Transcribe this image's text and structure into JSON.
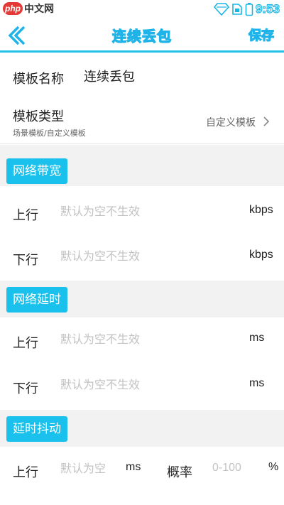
{
  "watermark": {
    "logo": "php",
    "text": "中文网"
  },
  "status_bar": {
    "time": "9:53"
  },
  "header": {
    "title": "连续丢包",
    "save_label": "保存"
  },
  "template_name": {
    "label": "模板名称",
    "value": "连续丢包"
  },
  "template_type": {
    "label": "模板类型",
    "sub_label": "场景模板/自定义模板",
    "value": "自定义模板"
  },
  "bandwidth": {
    "section_label": "网络带宽",
    "uplink": {
      "label": "上行",
      "placeholder": "默认为空不生效",
      "unit": "kbps"
    },
    "downlink": {
      "label": "下行",
      "placeholder": "默认为空不生效",
      "unit": "kbps"
    }
  },
  "latency": {
    "section_label": "网络延时",
    "uplink": {
      "label": "上行",
      "placeholder": "默认为空不生效",
      "unit": "ms"
    },
    "downlink": {
      "label": "下行",
      "placeholder": "默认为空不生效",
      "unit": "ms"
    }
  },
  "jitter": {
    "section_label": "延时抖动",
    "uplink": {
      "label": "上行",
      "placeholder": "默认为空",
      "unit": "ms",
      "probability_label": "概率",
      "probability_placeholder": "0-100",
      "probability_unit": "%"
    }
  },
  "colors": {
    "accent": "#19c1ec",
    "section_bg": "#f2f2f2",
    "placeholder": "#c2c2c2"
  },
  "icons": [
    "wifi-icon",
    "sim-icon",
    "battery-icon",
    "back-arrow-icon",
    "chevron-right-icon"
  ]
}
